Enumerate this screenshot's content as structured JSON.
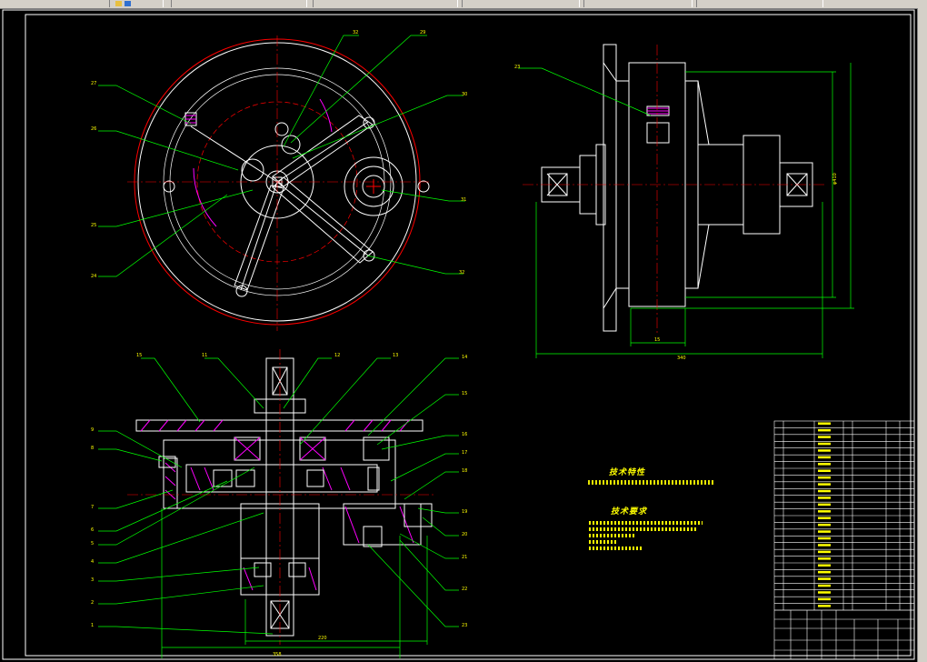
{
  "window": {
    "toolbar_segments": 6
  },
  "colors": {
    "background": "#000000",
    "frame": "#ffffff",
    "centerline": "#ff0000",
    "leader": "#00ff00",
    "hatch": "#ff00ff",
    "dimension": "#00ff00",
    "text": "#ffff00",
    "part": "#ffffff"
  },
  "drawing": {
    "technical_requirements_title": "技术特性",
    "notes_title": "技术要求"
  },
  "title_block": {
    "rows": 28
  }
}
